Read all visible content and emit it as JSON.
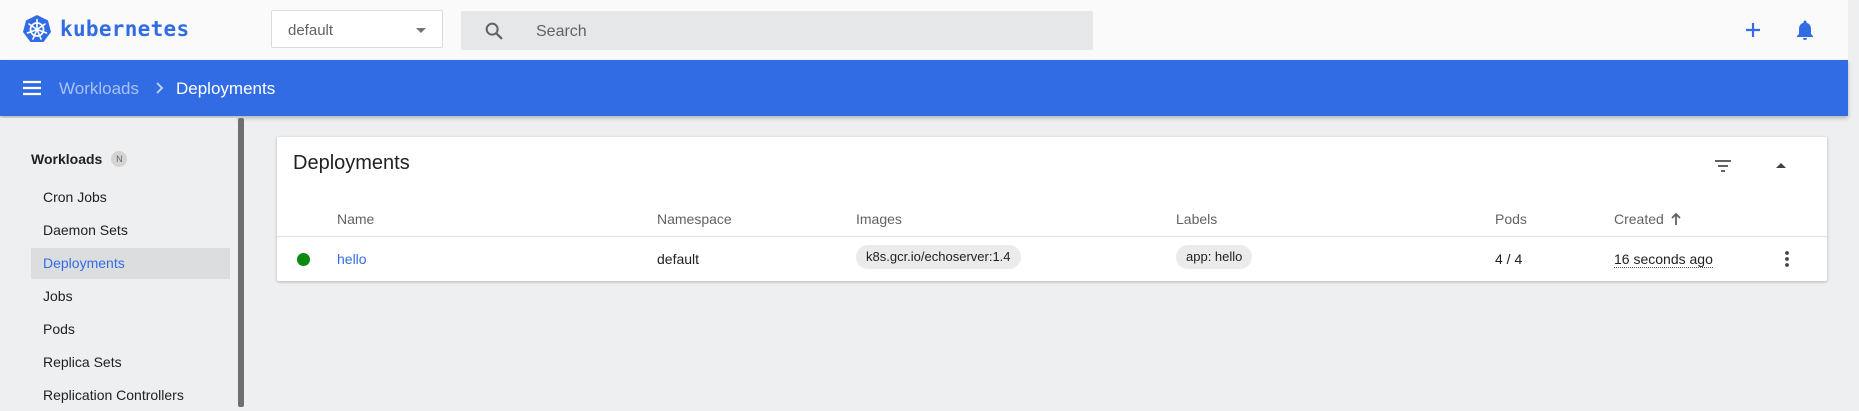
{
  "brand": {
    "name": "kubernetes",
    "accent": "#326ce5"
  },
  "namespace": {
    "selected": "default"
  },
  "search": {
    "placeholder": "Search"
  },
  "breadcrumb": {
    "parent": "Workloads",
    "current": "Deployments"
  },
  "sidebar": {
    "heading": "Workloads",
    "badge": "N",
    "items": [
      {
        "label": "Cron Jobs",
        "active": false
      },
      {
        "label": "Daemon Sets",
        "active": false
      },
      {
        "label": "Deployments",
        "active": true
      },
      {
        "label": "Jobs",
        "active": false
      },
      {
        "label": "Pods",
        "active": false
      },
      {
        "label": "Replica Sets",
        "active": false
      },
      {
        "label": "Replication Controllers",
        "active": false
      }
    ]
  },
  "card": {
    "title": "Deployments",
    "columns": [
      "Name",
      "Namespace",
      "Images",
      "Labels",
      "Pods",
      "Created"
    ],
    "sorted_by": "Created",
    "rows": [
      {
        "status": "running",
        "status_color": "#0b8a12",
        "name": "hello",
        "namespace": "default",
        "image": "k8s.gcr.io/echoserver:1.4",
        "label": "app: hello",
        "pods": "4 / 4",
        "created": "16 seconds ago"
      }
    ]
  },
  "icons": {
    "logo": "kubernetes-wheel-icon",
    "search": "search-icon",
    "add": "plus-icon",
    "notifications": "bell-icon",
    "menu": "hamburger-menu-icon",
    "filter": "filter-icon",
    "collapse": "caret-up-icon",
    "row_actions": "more-vertical-icon"
  }
}
